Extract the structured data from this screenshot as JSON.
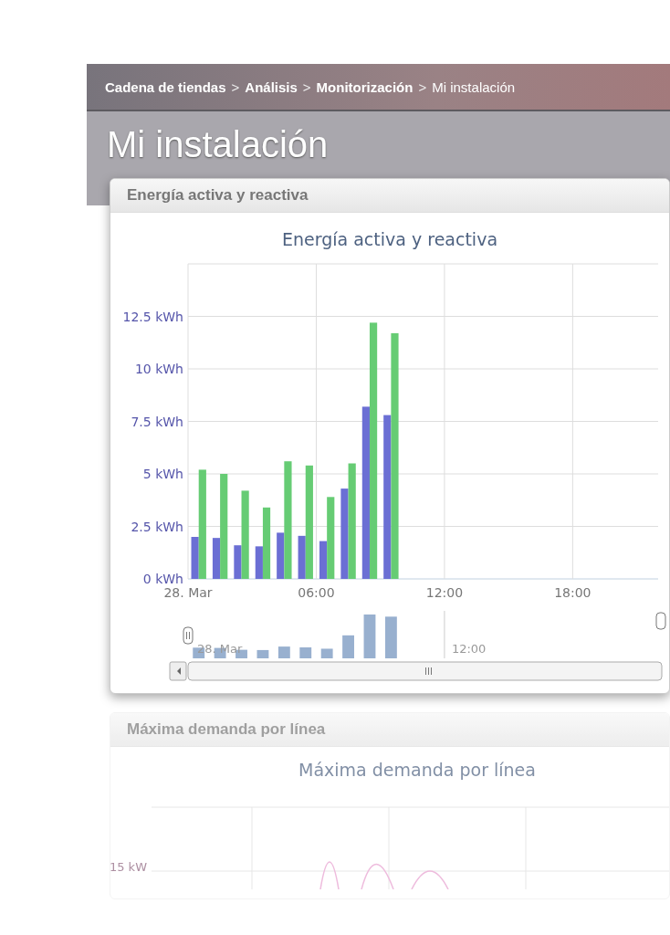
{
  "breadcrumb": {
    "items": [
      {
        "label": "Cadena de tiendas",
        "current": false
      },
      {
        "label": "Análisis",
        "current": false
      },
      {
        "label": "Monitorización",
        "current": false
      },
      {
        "label": "Mi instalación",
        "current": true
      }
    ],
    "separators": [
      ">",
      ">",
      ">"
    ]
  },
  "page_title": "Mi instalación",
  "panels": [
    {
      "header": "Energía activa y reactiva",
      "faded": false,
      "chart_data": {
        "type": "bar",
        "grid": true,
        "title": "Energía activa y reactiva",
        "x": [
          0.5,
          1.5,
          2.5,
          3.5,
          4.5,
          5.5,
          6.5,
          7.5,
          8.5,
          9.5
        ],
        "xlim": [
          0,
          22
        ],
        "ylim": [
          0,
          15
        ],
        "xticks": [
          {
            "value": 0,
            "label": "28. Mar"
          },
          {
            "value": 6,
            "label": "06:00"
          },
          {
            "value": 12,
            "label": "12:00"
          },
          {
            "value": 18,
            "label": "18:00"
          }
        ],
        "yticks": [
          {
            "value": 0,
            "label": "0 kWh"
          },
          {
            "value": 2.5,
            "label": "2.5 kWh"
          },
          {
            "value": 5,
            "label": "5 kWh"
          },
          {
            "value": 7.5,
            "label": "7.5 kWh"
          },
          {
            "value": 10,
            "label": "10 kWh"
          },
          {
            "value": 12.5,
            "label": "12.5 kWh"
          }
        ],
        "series": [
          {
            "color": "#6b6fd4",
            "values": [
              2.0,
              1.95,
              1.6,
              1.55,
              2.2,
              2.05,
              1.8,
              4.3,
              8.2,
              7.8
            ]
          },
          {
            "color": "#66cc74",
            "values": [
              5.2,
              5.0,
              4.2,
              3.4,
              5.6,
              5.4,
              3.9,
              5.5,
              12.2,
              11.7
            ]
          }
        ]
      },
      "navigator": {
        "labels": [
          "28. Mar",
          "12:00"
        ]
      }
    },
    {
      "header": "Máxima demanda por línea",
      "faded": true,
      "chart_title": "Máxima demanda por línea",
      "y_label": "15 kW"
    }
  ]
}
